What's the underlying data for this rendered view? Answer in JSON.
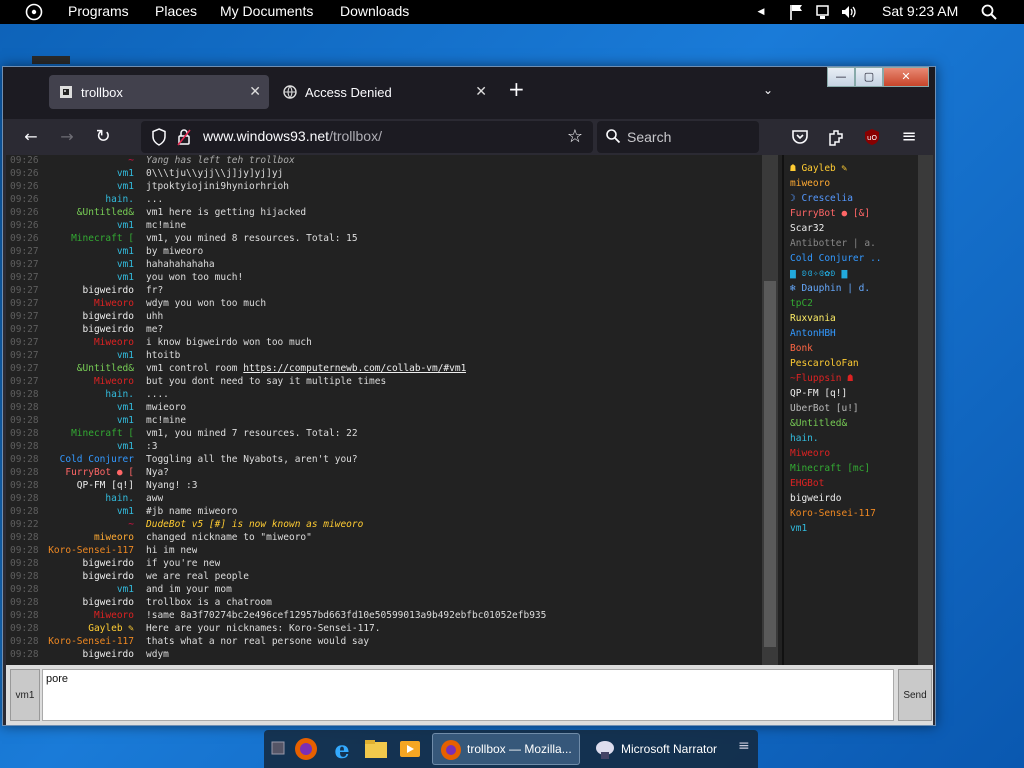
{
  "topbar": {
    "menus": [
      "Programs",
      "Places",
      "My Documents",
      "Downloads"
    ],
    "clock": "Sat 9:23 AM"
  },
  "browser": {
    "tabs": [
      {
        "title": "trollbox",
        "active": true
      },
      {
        "title": "Access Denied",
        "active": false
      }
    ],
    "url_host": "www.windows93.net",
    "url_path": "/trollbox/",
    "search_placeholder": "Search"
  },
  "chat": {
    "messages": [
      {
        "time": "09:26",
        "nick": "~",
        "nick_color": "#d14",
        "text": "Yang has left teh trollbox",
        "text_color": "#aaa"
      },
      {
        "time": "09:26",
        "nick": "vm1",
        "nick_color": "#3bd",
        "text": "0\\\\\\tju\\\\yjj\\\\j]jy]yj]yj"
      },
      {
        "time": "09:26",
        "nick": "vm1",
        "nick_color": "#3bd",
        "text": "jtpoktyiojini9hyniorhrioh"
      },
      {
        "time": "09:26",
        "nick": "hain.",
        "nick_color": "#3bd",
        "text": "..."
      },
      {
        "time": "09:26",
        "nick": "&Untitled&",
        "nick_color": "#7c5",
        "text": "vm1 here is getting hijacked"
      },
      {
        "time": "09:26",
        "nick": "vm1",
        "nick_color": "#3bd",
        "text": "mc!mine"
      },
      {
        "time": "09:26",
        "nick": "Minecraft [",
        "nick_color": "#3a3",
        "text": "vm1, you mined 8 resources. Total: 15"
      },
      {
        "time": "09:27",
        "nick": "vm1",
        "nick_color": "#3bd",
        "text": "by miweoro"
      },
      {
        "time": "09:27",
        "nick": "vm1",
        "nick_color": "#3bd",
        "text": "hahahahahaha"
      },
      {
        "time": "09:27",
        "nick": "vm1",
        "nick_color": "#3bd",
        "text": "you won too much!"
      },
      {
        "time": "09:27",
        "nick": "bigweirdo",
        "nick_color": "#eee",
        "text": "fr?"
      },
      {
        "time": "09:27",
        "nick": "Miweoro",
        "nick_color": "#d22",
        "text": "wdym you won too much"
      },
      {
        "time": "09:27",
        "nick": "bigweirdo",
        "nick_color": "#eee",
        "text": "uhh"
      },
      {
        "time": "09:27",
        "nick": "bigweirdo",
        "nick_color": "#eee",
        "text": "me?"
      },
      {
        "time": "09:27",
        "nick": "Miweoro",
        "nick_color": "#d22",
        "text": "i know bigweirdo won too much"
      },
      {
        "time": "09:27",
        "nick": "vm1",
        "nick_color": "#3bd",
        "text": "htoitb"
      },
      {
        "time": "09:27",
        "nick": "&Untitled&",
        "nick_color": "#7c5",
        "text": "vm1 control room https://computernewb.com/collab-vm/#vm1",
        "link": true
      },
      {
        "time": "09:27",
        "nick": "Miweoro",
        "nick_color": "#d22",
        "text": "but you dont need to say it multiple times"
      },
      {
        "time": "09:28",
        "nick": "hain.",
        "nick_color": "#3bd",
        "text": "...."
      },
      {
        "time": "09:28",
        "nick": "vm1",
        "nick_color": "#3bd",
        "text": "mwieoro"
      },
      {
        "time": "09:28",
        "nick": "vm1",
        "nick_color": "#3bd",
        "text": "mc!mine"
      },
      {
        "time": "09:28",
        "nick": "Minecraft [",
        "nick_color": "#3a3",
        "text": "vm1, you mined 7 resources. Total: 22"
      },
      {
        "time": "09:28",
        "nick": "vm1",
        "nick_color": "#3bd",
        "text": ":3"
      },
      {
        "time": "09:28",
        "nick": "Cold Conjurer",
        "nick_color": "#39f",
        "text": "Toggling all the Nyabots, aren't you?"
      },
      {
        "time": "09:28",
        "nick": "FurryBot ● [",
        "nick_color": "#f66",
        "text": "Nya?"
      },
      {
        "time": "09:28",
        "nick": "QP-FM [q!]",
        "nick_color": "#eee",
        "text": "Nyang! :3"
      },
      {
        "time": "09:28",
        "nick": "hain.",
        "nick_color": "#3bd",
        "text": "aww"
      },
      {
        "time": "09:28",
        "nick": "vm1",
        "nick_color": "#3bd",
        "text": "#jb name miweoro"
      },
      {
        "time": "09:22",
        "nick": "~",
        "nick_color": "#d14",
        "text": "DudeBot v5 [#] is now known as miweoro",
        "text_color": "#fc3"
      },
      {
        "time": "09:28",
        "nick": "miweoro",
        "nick_color": "#fa3",
        "text": "changed nickname to \"miweoro\""
      },
      {
        "time": "09:28",
        "nick": "Koro-Sensei-117",
        "nick_color": "#e82",
        "text": "hi im new"
      },
      {
        "time": "09:28",
        "nick": "bigweirdo",
        "nick_color": "#eee",
        "text": "if you're new"
      },
      {
        "time": "09:28",
        "nick": "bigweirdo",
        "nick_color": "#eee",
        "text": "we are real people"
      },
      {
        "time": "09:28",
        "nick": "vm1",
        "nick_color": "#3bd",
        "text": "and im your mom"
      },
      {
        "time": "09:28",
        "nick": "bigweirdo",
        "nick_color": "#eee",
        "text": "trollbox is a chatroom"
      },
      {
        "time": "09:28",
        "nick": "Miweoro",
        "nick_color": "#d22",
        "text": "!same 8a3f70274bc2e496cef12957bd663fd10e50599013a9b492ebfbc01052efb935"
      },
      {
        "time": "09:28",
        "nick": "Gayleb ✎",
        "nick_color": "#fc3",
        "text": "Here are your nicknames: Koro-Sensei-117."
      },
      {
        "time": "09:28",
        "nick": "Koro-Sensei-117",
        "nick_color": "#e82",
        "text": "thats what a nor real persone would say"
      },
      {
        "time": "09:28",
        "nick": "bigweirdo",
        "nick_color": "#eee",
        "text": "wdym"
      }
    ]
  },
  "users": [
    {
      "name": "☗ Gayleb ✎",
      "color": "#fc3"
    },
    {
      "name": "miweoro",
      "color": "#fa3"
    },
    {
      "name": "☽ Crescelia",
      "color": "#59f"
    },
    {
      "name": "FurryBot ● [&]",
      "color": "#f66"
    },
    {
      "name": "Scar32",
      "color": "#eee"
    },
    {
      "name": "Antibotter | a.",
      "color": "#888"
    },
    {
      "name": "Cold Conjurer ..",
      "color": "#39f"
    },
    {
      "name": "▆ ʚɞ✧ɞ✿ʚ ▆",
      "color": "#2ad"
    },
    {
      "name": "❄ Dauphin | d.",
      "color": "#6af"
    },
    {
      "name": "tpC2",
      "color": "#3a3"
    },
    {
      "name": "Ruxvania",
      "color": "#fe6"
    },
    {
      "name": "AntonHBH",
      "color": "#39f"
    },
    {
      "name": "Bonk",
      "color": "#f64"
    },
    {
      "name": "PescaroloFan",
      "color": "#fc3"
    },
    {
      "name": "~Fluppsin ☗",
      "color": "#d22"
    },
    {
      "name": "QP-FM [q!]",
      "color": "#eee"
    },
    {
      "name": "UberBot [u!]",
      "color": "#bbb"
    },
    {
      "name": "&Untitled&",
      "color": "#7c5"
    },
    {
      "name": "hain.",
      "color": "#3bd"
    },
    {
      "name": "Miweoro",
      "color": "#d22"
    },
    {
      "name": "Minecraft [mc]",
      "color": "#3a3"
    },
    {
      "name": "EHGBot",
      "color": "#d22"
    },
    {
      "name": "bigweirdo",
      "color": "#eee"
    },
    {
      "name": "Koro-Sensei-117",
      "color": "#e82"
    },
    {
      "name": "vm1",
      "color": "#3bd"
    }
  ],
  "bottom": {
    "nick": "vm1",
    "input_value": "pore",
    "send_label": "Send"
  },
  "taskbar": {
    "apps": [
      "trollbox — Mozilla...",
      "Microsoft Narrator"
    ]
  }
}
